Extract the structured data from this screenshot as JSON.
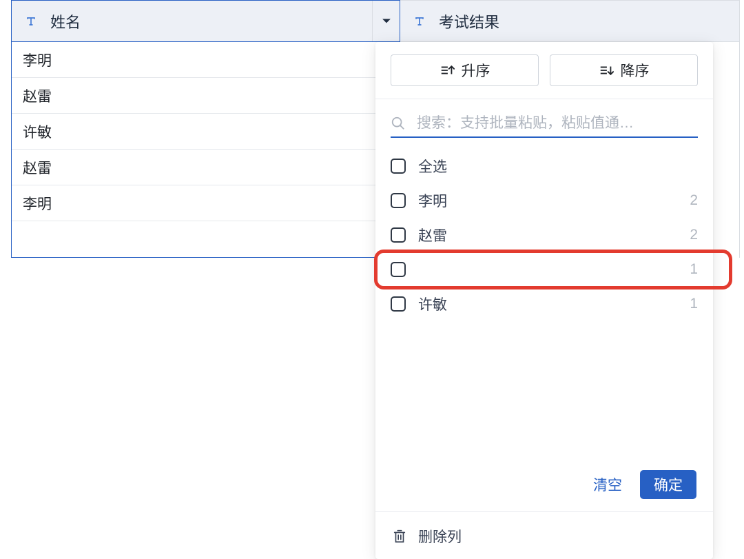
{
  "columns": {
    "name": {
      "header": "姓名"
    },
    "result": {
      "header": "考试结果"
    }
  },
  "rows": [
    {
      "name": "李明"
    },
    {
      "name": "赵雷"
    },
    {
      "name": "许敏"
    },
    {
      "name": "赵雷"
    },
    {
      "name": "李明"
    }
  ],
  "dropdown": {
    "sort_asc": "升序",
    "sort_desc": "降序",
    "search_placeholder": "搜索：支持批量粘贴，粘贴值通…",
    "select_all": "全选",
    "options": [
      {
        "label": "李明",
        "count": "2"
      },
      {
        "label": "赵雷",
        "count": "2"
      },
      {
        "label": "",
        "count": "1",
        "highlighted": true
      },
      {
        "label": "许敏",
        "count": "1"
      }
    ],
    "clear": "清空",
    "confirm": "确定",
    "delete_column": "删除列"
  }
}
